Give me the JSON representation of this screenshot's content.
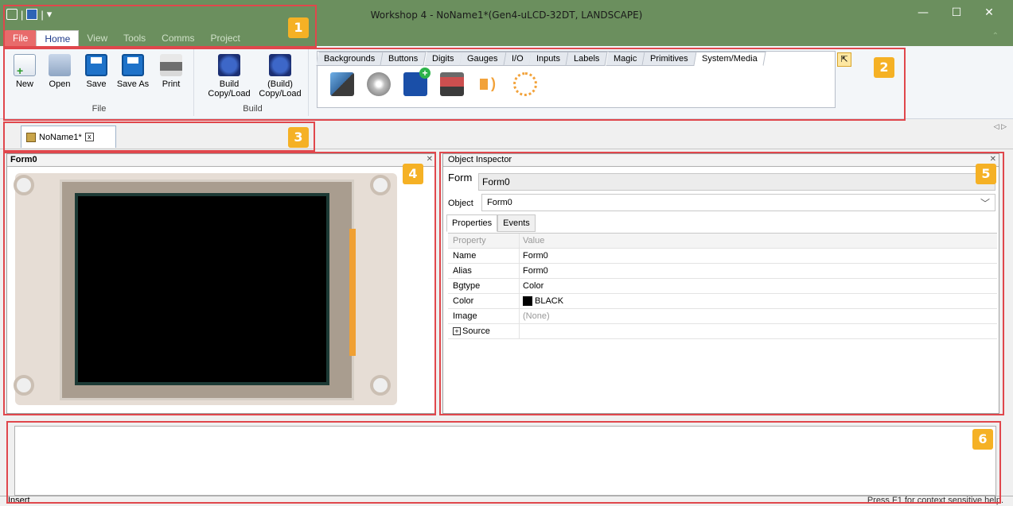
{
  "window": {
    "title": "Workshop 4 - NoName1*(Gen4-uLCD-32DT, LANDSCAPE)",
    "controls": {
      "minimize": "—",
      "maximize": "☐",
      "close": "✕"
    }
  },
  "menu_tabs": [
    "File",
    "Home",
    "View",
    "Tools",
    "Comms",
    "Project"
  ],
  "active_menu": "Home",
  "ribbon": {
    "file_group": {
      "label": "File",
      "buttons": [
        "New",
        "Open",
        "Save",
        "Save As",
        "Print"
      ]
    },
    "build_group": {
      "label": "Build",
      "buttons": [
        {
          "line1": "Build",
          "line2": "Copy/Load"
        },
        {
          "line1": "(Build)",
          "line2": "Copy/Load"
        }
      ]
    },
    "palette_tabs": [
      "Backgrounds",
      "Buttons",
      "Digits",
      "Gauges",
      "I/O",
      "Inputs",
      "Labels",
      "Magic",
      "Primitives",
      "System/Media"
    ],
    "active_palette": "System/Media",
    "palette_icons": [
      "image-camera-icon",
      "disc-icon",
      "new-form-icon",
      "video-icon",
      "sound-icon",
      "timer-icon"
    ]
  },
  "document": {
    "tab_label": "NoName1*",
    "close_glyph": "x"
  },
  "form_panel": {
    "title": "Form0"
  },
  "inspector": {
    "title": "Object Inspector",
    "form_label": "Form",
    "form_value": "Form0",
    "object_label": "Object",
    "object_value": "Form0",
    "tabs": [
      "Properties",
      "Events"
    ],
    "columns": [
      "Property",
      "Value"
    ],
    "rows": [
      {
        "property": "Name",
        "value": "Form0"
      },
      {
        "property": "Alias",
        "value": "Form0"
      },
      {
        "property": "Bgtype",
        "value": "Color"
      },
      {
        "property": "Color",
        "value": "BLACK",
        "swatch": "#000000"
      },
      {
        "property": "Image",
        "value": "(None)"
      },
      {
        "property": "Source",
        "value": ""
      }
    ]
  },
  "status": {
    "left": "Insert",
    "right": "Press F1 for context sensitive help."
  },
  "callouts": [
    "1",
    "2",
    "3",
    "4",
    "5",
    "6"
  ],
  "colors": {
    "callout_border": "#e0474c",
    "callout_badge": "#f5b125",
    "titlebar": "#6b8f5e"
  }
}
